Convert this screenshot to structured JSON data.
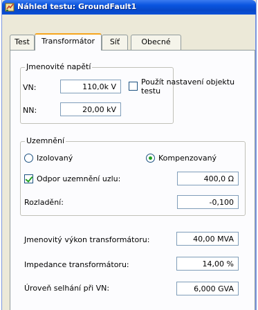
{
  "window": {
    "title": "Náhled testu: GroundFault1",
    "app_icon": "test-preview-icon"
  },
  "tabs": [
    {
      "label": "Test",
      "active": false
    },
    {
      "label": "Transformátor",
      "active": true
    },
    {
      "label": "Síť",
      "active": false
    },
    {
      "label": "Obecné",
      "active": false
    }
  ],
  "rated_voltage": {
    "legend": "Jmenovité napětí",
    "vn_label": "VN:",
    "vn_value": "110,0k V",
    "nn_label": "NN:",
    "nn_value": "20,00 kV",
    "use_test_object_label_1": "Použít nastavení objektu",
    "use_test_object_label_2": "testu",
    "use_test_object_checked": false
  },
  "grounding": {
    "legend": "Uzemnění",
    "isolated_label": "Izolovaný",
    "isolated_checked": false,
    "compensated_label": "Kompenzovaný",
    "compensated_checked": true,
    "neutral_resistance_label": "Odpor uzemnění uzlu:",
    "neutral_resistance_checked": true,
    "neutral_resistance_value": "400,0 Ω",
    "detuning_label": "Rozladění:",
    "detuning_value": "-0,100"
  },
  "transformer": {
    "rated_power_label": "Jmenovitý výkon transformátoru:",
    "rated_power_value": "40,00 MVA",
    "impedance_label": "Impedance transformátoru:",
    "impedance_value": "14,00 %",
    "fault_level_label": "Úroveň selhání při VN:",
    "fault_level_value": "6,000 GVA"
  }
}
